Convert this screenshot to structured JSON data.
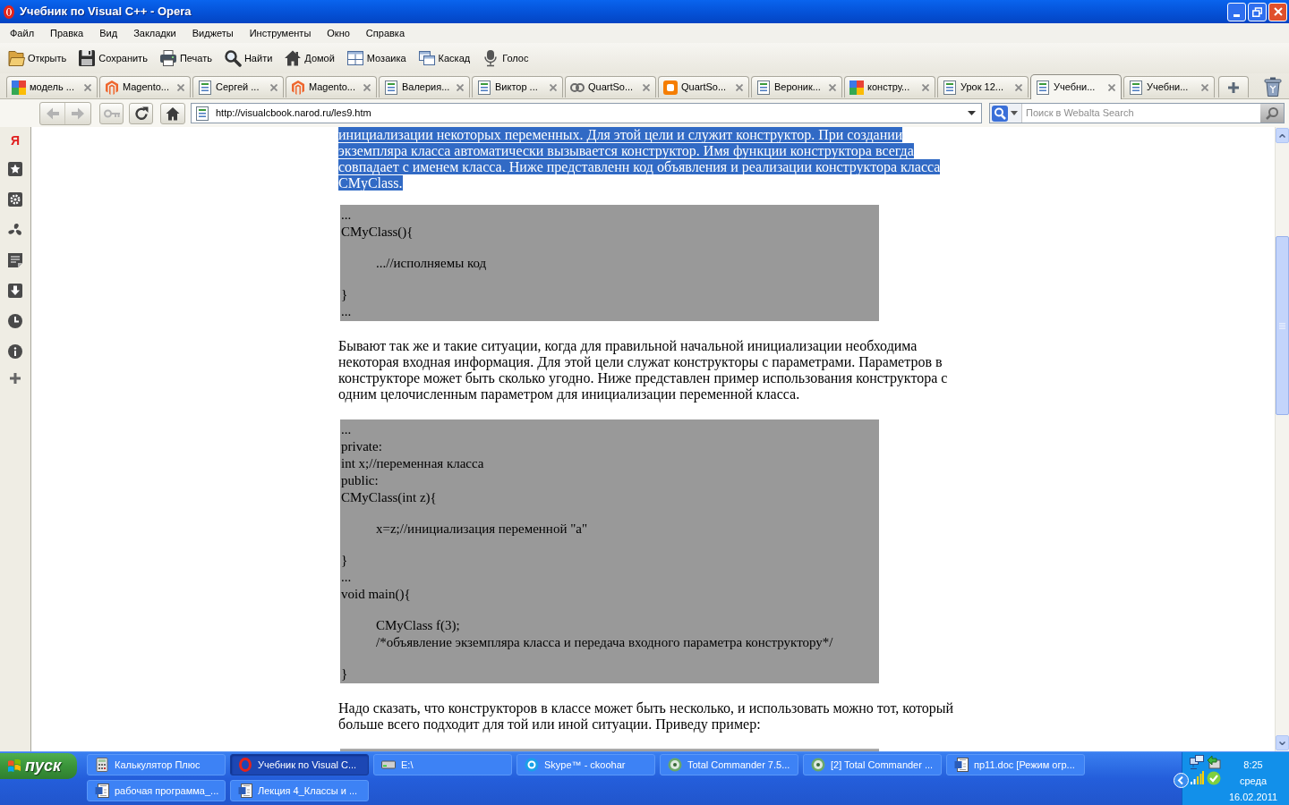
{
  "window": {
    "title": "Учебник по Visual C++ - Opera"
  },
  "menu": [
    "Файл",
    "Правка",
    "Вид",
    "Закладки",
    "Виджеты",
    "Инструменты",
    "Окно",
    "Справка"
  ],
  "toolbar": [
    {
      "label": "Открыть",
      "kind": "open"
    },
    {
      "label": "Сохранить",
      "kind": "save"
    },
    {
      "label": "Печать",
      "kind": "print"
    },
    {
      "label": "Найти",
      "kind": "find"
    },
    {
      "label": "Домой",
      "kind": "home"
    },
    {
      "label": "Мозаика",
      "kind": "tile"
    },
    {
      "label": "Каскад",
      "kind": "cascade"
    },
    {
      "label": "Голос",
      "kind": "voice"
    }
  ],
  "tabs": [
    {
      "title": "модель ...",
      "kind": "google",
      "selected": false
    },
    {
      "title": "Magento...",
      "kind": "magento",
      "selected": false
    },
    {
      "title": "Сергей ...",
      "kind": "page",
      "selected": false
    },
    {
      "title": "Magento...",
      "kind": "magento",
      "selected": false
    },
    {
      "title": "Валерия...",
      "kind": "page",
      "selected": false
    },
    {
      "title": "Виктор ...",
      "kind": "page",
      "selected": false
    },
    {
      "title": "QuartSo...",
      "kind": "quartsoft",
      "selected": false
    },
    {
      "title": "QuartSo...",
      "kind": "blogger",
      "selected": false
    },
    {
      "title": "Вероник...",
      "kind": "page",
      "selected": false
    },
    {
      "title": "констру...",
      "kind": "google",
      "selected": false
    },
    {
      "title": "Урок 12...",
      "kind": "page",
      "selected": false
    },
    {
      "title": "Учебни...",
      "kind": "page",
      "selected": true
    },
    {
      "title": "Учебни...",
      "kind": "page",
      "selected": false
    }
  ],
  "nav_buttons": [
    {
      "kind": "back",
      "disabled": true
    },
    {
      "kind": "forward",
      "disabled": true
    },
    {
      "kind": "wand",
      "disabled": true
    },
    {
      "kind": "reload",
      "disabled": false
    },
    {
      "kind": "home",
      "disabled": false
    }
  ],
  "address_bar": {
    "url": "http://visualcbook.narod.ru/les9.htm"
  },
  "search": {
    "placeholder": "Поиск в Webalta Search"
  },
  "side_panel": {
    "first_item": "Я"
  },
  "page": {
    "blocks": [
      {
        "kind": "text",
        "selected": true,
        "text": "инициализации некоторых переменных. Для этой цели и служит конструктор. При создании экземпляра класса автоматически вызывается конструктор. Имя функции конструктора всегда совпадает с именем класса. Ниже представленн код объявления и реализации конструктора класса CMyClass."
      },
      {
        "kind": "code",
        "lines": [
          {
            "text": "..."
          },
          {
            "text": "CMyClass(){",
            "children": [
              {
                "text": "...//исполняемы код"
              }
            ]
          },
          {
            "text": "}"
          },
          {
            "text": "..."
          }
        ]
      },
      {
        "kind": "text",
        "selected": false,
        "text": "Бывают так же и такие ситуации, когда для правильной начальной инициализации необходима некоторая входная информация. Для этой цели служат конструкторы с параметрами. Параметров в конструкторе может быть сколько угодно. Ниже представлен пример использования конструктора с одним целочисленным параметром для инициализации переменной класса."
      },
      {
        "kind": "code",
        "lines": [
          {
            "text": "..."
          },
          {
            "text": "private:"
          },
          {
            "text": "int x;//переменная класса"
          },
          {
            "text": "public:"
          },
          {
            "text": "CMyClass(int z){",
            "children": [
              {
                "text": "x=z;//инициализация переменной \"a\""
              }
            ]
          },
          {
            "text": "}"
          },
          {
            "text": "..."
          },
          {
            "text": "void main(){",
            "children": [
              {
                "text": "CMyClass f(3);"
              },
              {
                "text": "/*объявление экземпляра класса и передача входного параметра конструктору*/"
              }
            ]
          },
          {
            "text": "}"
          }
        ]
      },
      {
        "kind": "text",
        "selected": false,
        "text": "Надо сказать, что конструкторов в классе может быть несколько, и использовать можно тот, который больше всего подходит для той или иной ситуации. Приведу пример:"
      }
    ]
  },
  "taskbar": {
    "start": "пуск",
    "task_rows": [
      {
        "tasks": [
          {
            "label": "Калькулятор Плюс",
            "kind": "calculator",
            "selected": false
          },
          {
            "label": "Учебник по Visual C...",
            "kind": "opera",
            "selected": true
          },
          {
            "label": "E:\\",
            "kind": "drive",
            "selected": false
          },
          {
            "label": "Skype™ - ckoohar",
            "kind": "skype",
            "selected": false
          },
          {
            "label": "Total Commander 7.5...",
            "kind": "commander",
            "selected": false
          },
          {
            "label": "[2] Total Commander ...",
            "kind": "commander",
            "selected": false
          },
          {
            "label": "пр11.doc [Режим огр...",
            "kind": "word",
            "selected": false
          }
        ]
      },
      {
        "tasks": [
          {
            "label": "рабочая программа_...",
            "kind": "word",
            "selected": false
          },
          {
            "label": "Лекция 4_Классы и ...",
            "kind": "word",
            "selected": false
          }
        ]
      }
    ],
    "clock": {
      "time": "8:25",
      "day": "среда",
      "date": "16.02.2011"
    }
  }
}
